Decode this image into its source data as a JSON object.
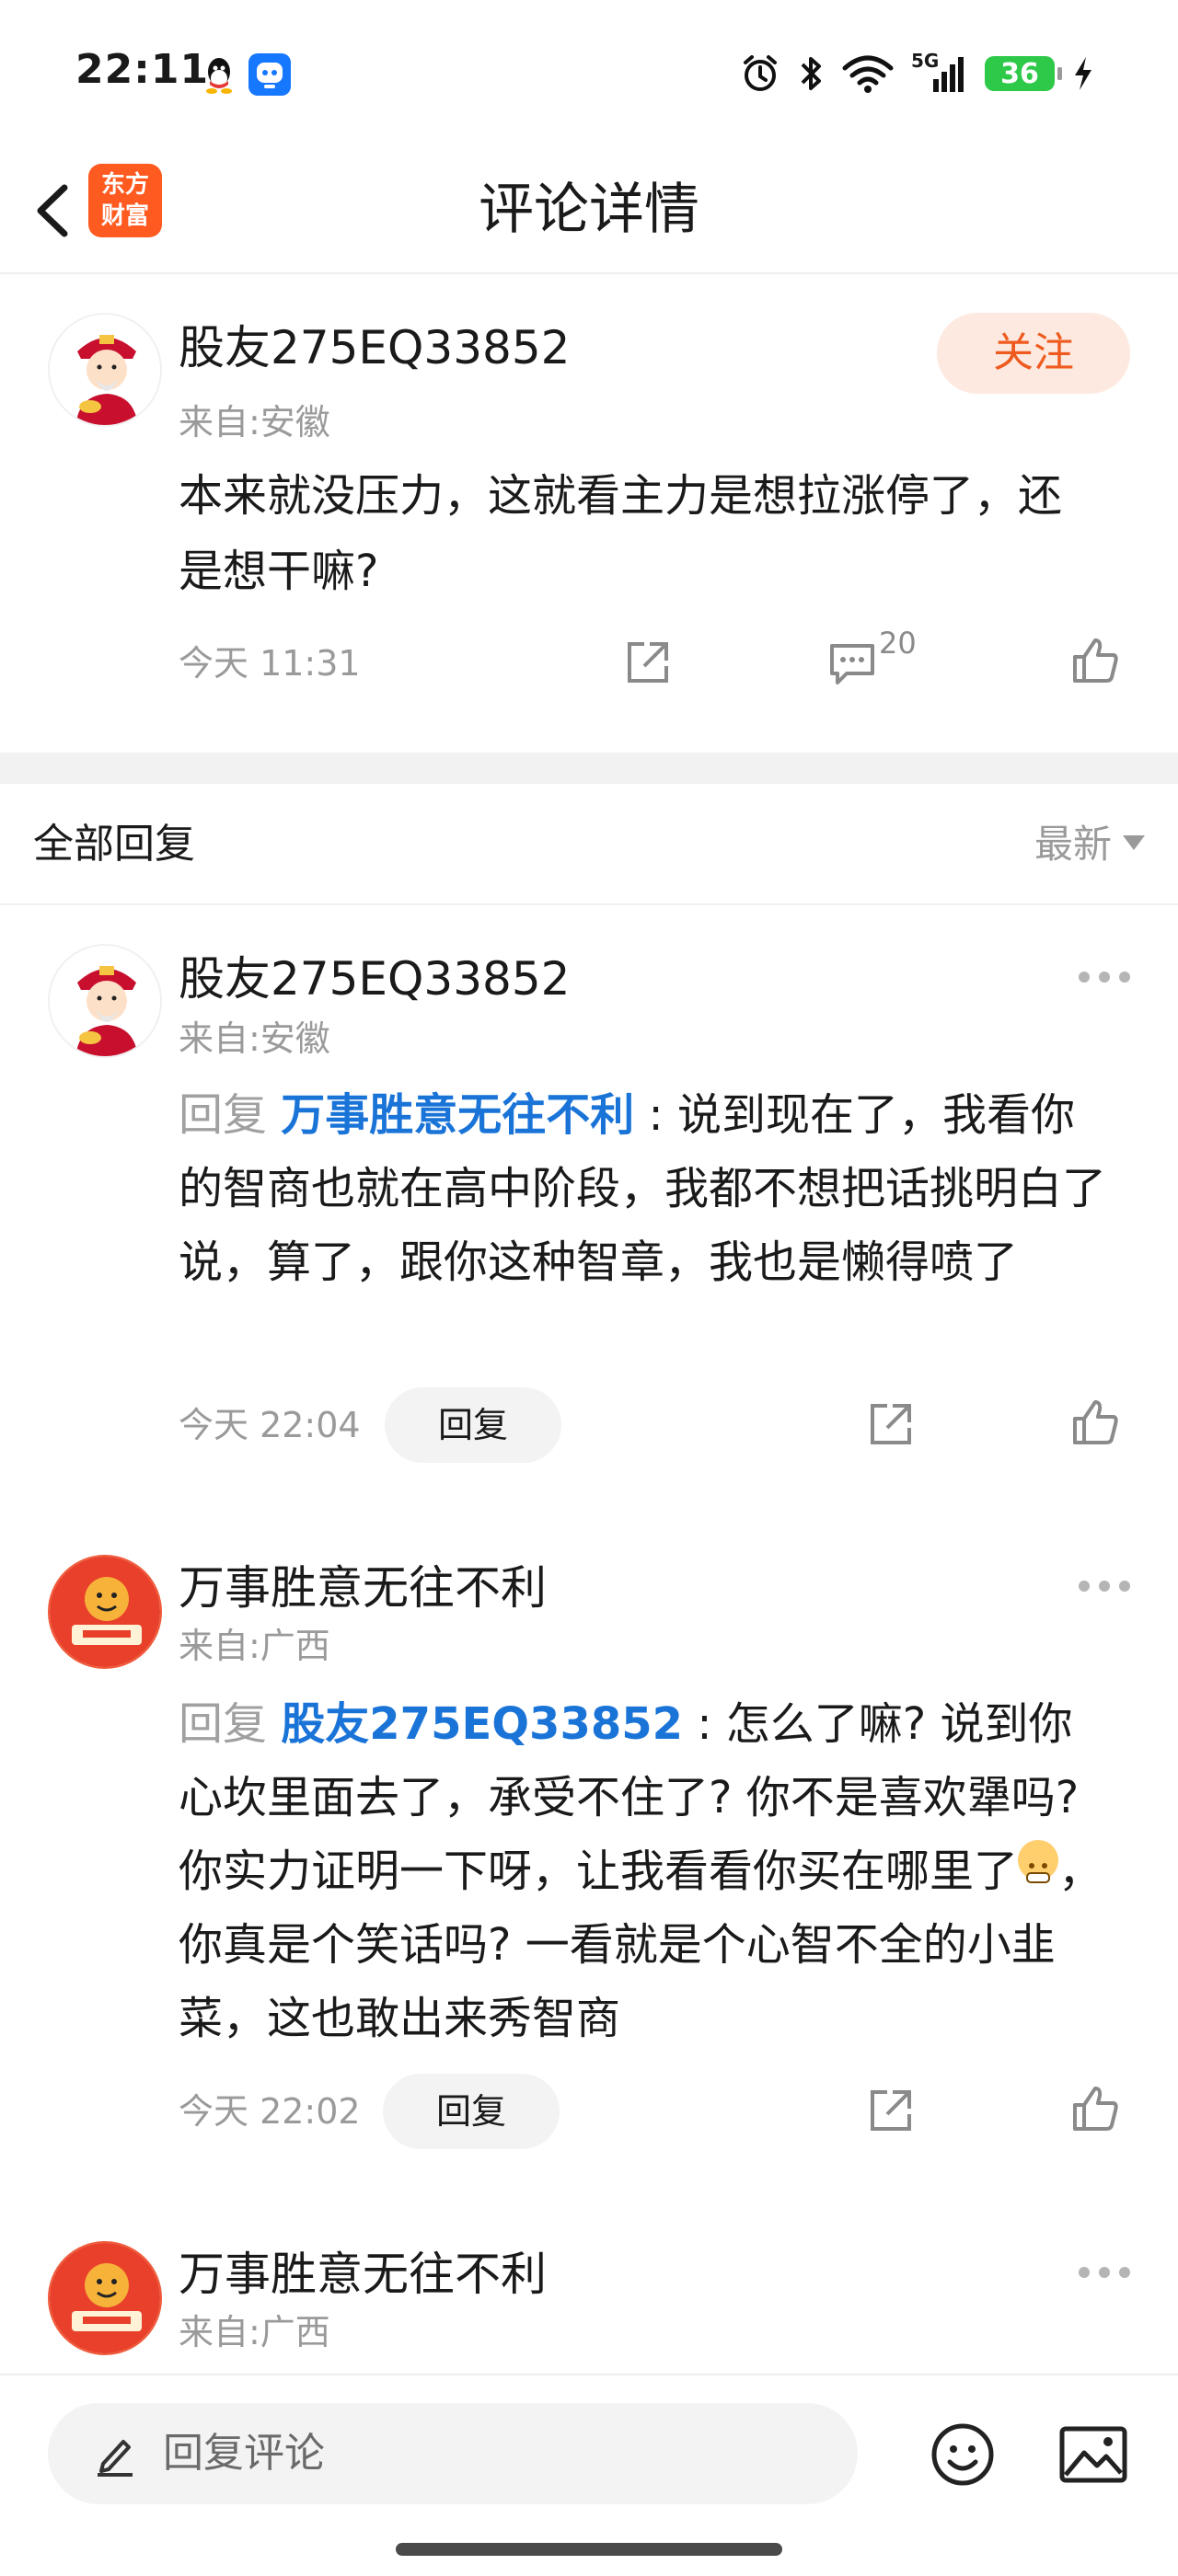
{
  "status_bar": {
    "time": "22:11",
    "battery": "36",
    "network": "5G",
    "icons": [
      "qq-icon",
      "app-icon",
      "alarm-icon",
      "bluetooth-icon",
      "wifi-icon",
      "signal-icon",
      "battery-icon",
      "charging-icon"
    ]
  },
  "header": {
    "title": "评论详情",
    "logo_line1": "东方",
    "logo_line2": "财富"
  },
  "post": {
    "username": "股友275EQ33852",
    "from": "来自:安徽",
    "follow_label": "关注",
    "text": "本来就没压力，这就看主力是想拉涨停了，还是想干嘛?",
    "time": "今天 11:31",
    "comment_count": "20"
  },
  "section": {
    "title": "全部回复",
    "sort_label": "最新"
  },
  "replies": [
    {
      "username": "股友275EQ33852",
      "from": "来自:安徽",
      "prefix": "回复 ",
      "mention": "万事胜意无往不利",
      "text": " : 说到现在了，我看你的智商也就在高中阶段，我都不想把话挑明白了说，算了，跟你这种智章，我也是懒得喷了",
      "time": "今天 22:04",
      "reply_label": "回复"
    },
    {
      "username": "万事胜意无往不利",
      "from": "来自:广西",
      "prefix": "回复 ",
      "mention": "股友275EQ33852",
      "text_before_emoji": " : 怎么了嘛? 说到你心坎里面去了，承受不住了? 你不是喜欢犟吗? 你实力证明一下呀，让我看看你买在哪里了",
      "text_after_emoji": "，你真是个笑话吗? 一看就是个心智不全的小韭菜，这也敢出来秀智商",
      "time": "今天 22:02",
      "reply_label": "回复"
    },
    {
      "username": "万事胜意无往不利",
      "from": "来自:广西"
    }
  ],
  "bottom_bar": {
    "input_placeholder": "回复评论"
  },
  "colors": {
    "accent": "#ef5a1e",
    "mention": "#1a74d8",
    "muted": "#9a9a9a"
  }
}
